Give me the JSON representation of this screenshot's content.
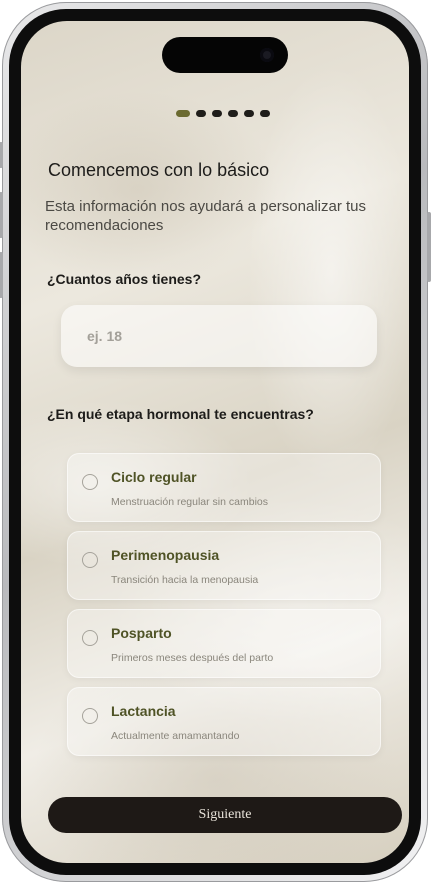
{
  "progress": {
    "total_steps": 6,
    "current_step": 1
  },
  "header": {
    "title": "Comencemos con lo básico",
    "subtitle": "Esta información nos ayudará a personalizar tus recomendaciones"
  },
  "age_question": {
    "label": "¿Cuantos años tienes?",
    "placeholder": "ej. 18",
    "value": ""
  },
  "stage_question": {
    "label": "¿En qué etapa hormonal te encuentras?",
    "options": [
      {
        "title": "Ciclo regular",
        "description": "Menstruación regular sin cambios",
        "selected": false
      },
      {
        "title": "Perimenopausia",
        "description": "Transición hacia la menopausia",
        "selected": false
      },
      {
        "title": "Posparto",
        "description": "Primeros meses después del parto",
        "selected": false
      },
      {
        "title": "Lactancia",
        "description": "Actualmente amamantando",
        "selected": false
      }
    ]
  },
  "footer": {
    "next_label": "Siguiente"
  },
  "colors": {
    "accent": "#6b6a30",
    "option_title": "#4f5326",
    "button_bg": "#1e1916",
    "text_dark": "#1d1c1a"
  }
}
